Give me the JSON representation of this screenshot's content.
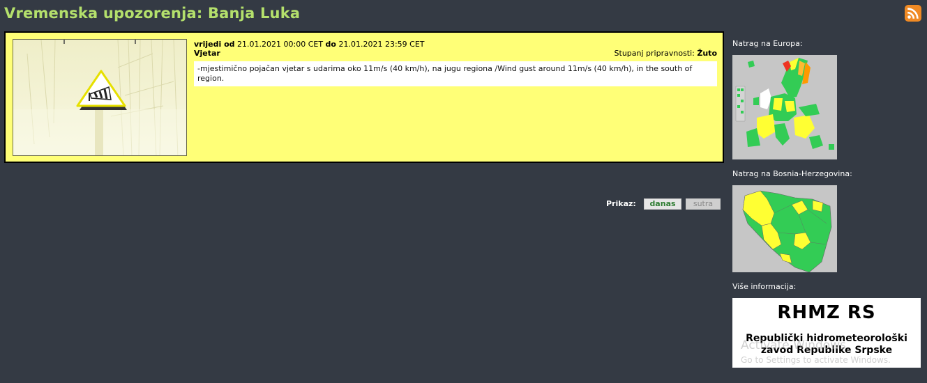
{
  "header": {
    "title": "Vremenska upozorenja: Banja Luka"
  },
  "warning": {
    "valid_from_label": "vrijedi od",
    "valid_from": "21.01.2021 00:00 CET",
    "valid_to_label": "do",
    "valid_to": "21.01.2021 23:59 CET",
    "type": "Vjetar",
    "level_label": "Stupanj pripravnosti:",
    "level": "Žuto",
    "description": "-mjestimično pojačan vjetar s udarima oko 11m/s (40 km/h), na jugu regiona /Wind gust around 11m/s (40 km/h), in the south of region.",
    "icon": "wind-warning-icon"
  },
  "view": {
    "label": "Prikaz:",
    "today": "danas",
    "tomorrow": "sutra"
  },
  "sidebar": {
    "back_europe": "Natrag na Europa:",
    "back_bih": "Natrag na Bosnia-Herzegovina:",
    "more_info": "Više informacija:",
    "rhmz_title": "RHMZ RS",
    "rhmz_line1": "Republički hidrometeorološki",
    "rhmz_line2": "zavod Republike Srpske"
  },
  "watermark": {
    "line1": "Activate Windows",
    "line2": "Go to Settings to activate Windows."
  },
  "colors": {
    "background": "#343a44",
    "title": "#b4e06c",
    "warning_yellow": "#ffff77",
    "map_green": "#33cc55",
    "map_yellow": "#ffff33"
  }
}
